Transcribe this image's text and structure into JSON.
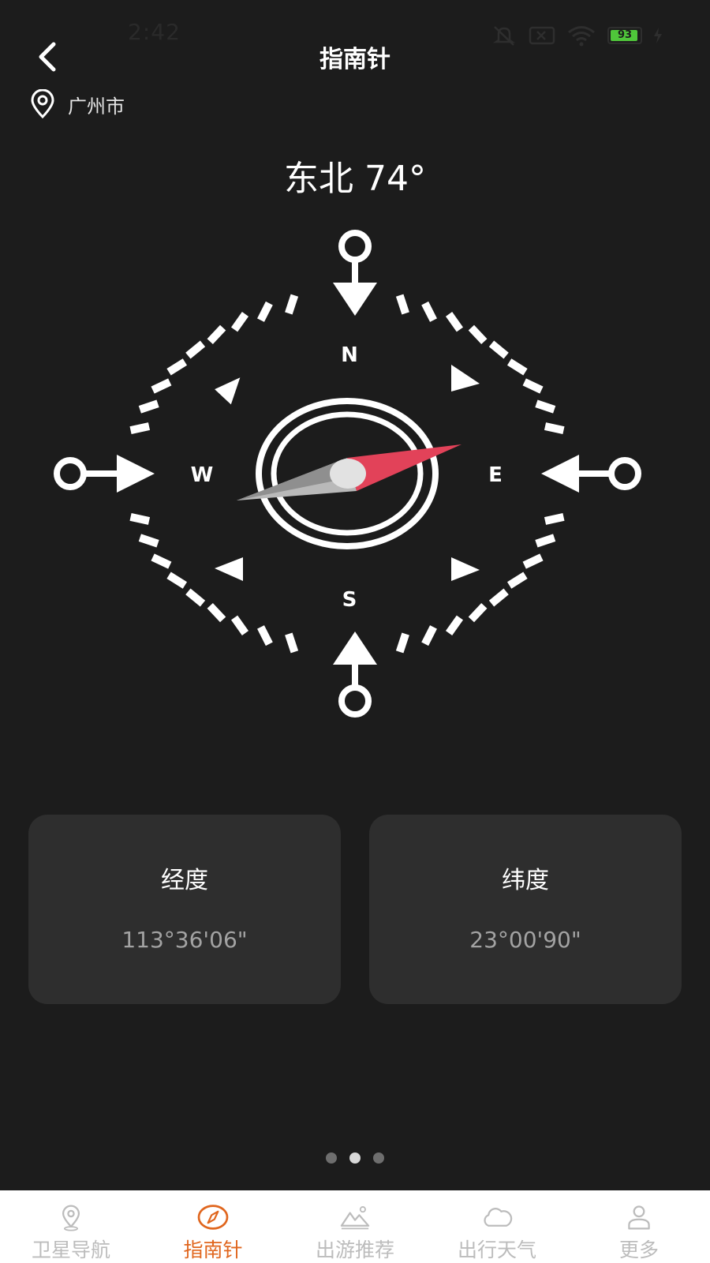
{
  "status_bar": {
    "time": "2:42",
    "battery_level": "93",
    "icons": [
      "mute-icon",
      "sim-icon",
      "wifi-icon",
      "battery-icon",
      "charging-icon"
    ]
  },
  "header": {
    "title": "指南针",
    "back_icon": "chevron-left-icon"
  },
  "location": {
    "icon": "location-pin-icon",
    "city": "广州市"
  },
  "compass": {
    "heading_text": "东北 74°",
    "cardinals": {
      "north": "N",
      "south": "S",
      "east": "E",
      "west": "W"
    }
  },
  "cards": [
    {
      "label": "经度",
      "value": "113°36'06\""
    },
    {
      "label": "纬度",
      "value": "23°00'90\""
    }
  ],
  "pager": {
    "count": 3,
    "active_index": 1
  },
  "tab_bar": {
    "active_tab": "指南针",
    "accent_color": "#e0661e",
    "items": [
      {
        "label": "卫星导航",
        "icon": "map-pin-icon"
      },
      {
        "label": "指南针",
        "icon": "compass-icon"
      },
      {
        "label": "出游推荐",
        "icon": "mountain-icon"
      },
      {
        "label": "出行天气",
        "icon": "cloud-icon"
      },
      {
        "label": "更多",
        "icon": "user-icon"
      }
    ]
  }
}
